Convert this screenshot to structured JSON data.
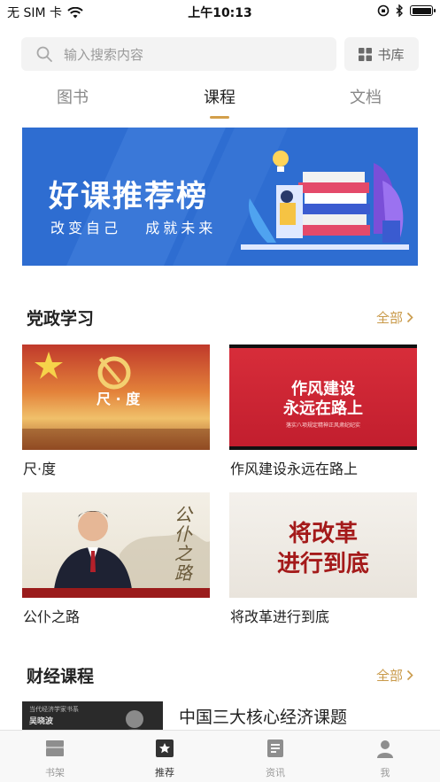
{
  "status_bar": {
    "carrier": "无 SIM 卡",
    "time": "上午10:13"
  },
  "search": {
    "placeholder": "输入搜索内容"
  },
  "library_button": {
    "label": "书库"
  },
  "tabs": [
    {
      "label": "图书",
      "active": false
    },
    {
      "label": "课程",
      "active": true
    },
    {
      "label": "文档",
      "active": false
    }
  ],
  "banner": {
    "title": "好课推荐榜",
    "subtitle": "改变自己   成就未来"
  },
  "sections": [
    {
      "title": "党政学习",
      "more": "全部",
      "items": [
        {
          "label": "尺·度",
          "thumb_text": "尺 · 度"
        },
        {
          "label": "作风建设永远在路上",
          "thumb_text_1": "作风建设",
          "thumb_text_2": "永远在路上",
          "thumb_caption": "落实八项规定精神正风肃纪纪实"
        },
        {
          "label": "公仆之路",
          "thumb_text": "公仆之路"
        },
        {
          "label": "将改革进行到底",
          "thumb_text_1": "将改革",
          "thumb_text_2": "进行到底"
        }
      ]
    },
    {
      "title": "财经课程",
      "more": "全部",
      "items": [
        {
          "label": "中国三大核心经济课题",
          "thumb_caption": "当代经济学家书系",
          "thumb_author": "吴晓波"
        }
      ]
    }
  ],
  "bottom_nav": [
    {
      "label": "书架",
      "icon": "bookshelf-icon",
      "active": false
    },
    {
      "label": "推荐",
      "icon": "star-icon",
      "active": true
    },
    {
      "label": "资讯",
      "icon": "news-icon",
      "active": false
    },
    {
      "label": "我",
      "icon": "person-icon",
      "active": false
    }
  ],
  "colors": {
    "accent": "#c99a4a",
    "banner_blue": "#2e6dd1",
    "party_red": "#c8242f"
  }
}
